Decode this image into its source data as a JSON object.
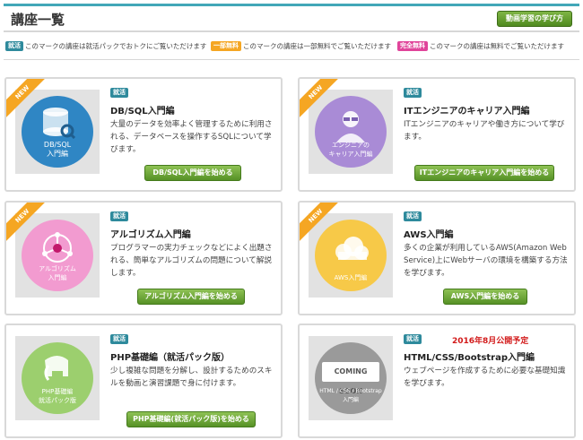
{
  "header": {
    "title": "講座一覧",
    "how_to_button": "動画学習の学び方"
  },
  "legend": [
    {
      "chip": "就活",
      "chip_color": "#2e8a9c",
      "text": "このマークの講座は就活パックでおトクにご覧いただけます"
    },
    {
      "chip": "一部無料",
      "chip_color": "#f5a623",
      "text": "このマークの講座は一部無料でご覧いただけます"
    },
    {
      "chip": "完全無料",
      "chip_color": "#e0449a",
      "text": "このマークの講座は無料でご覧いただけます"
    }
  ],
  "courses": [
    {
      "ribbon": "NEW",
      "tag": "就活",
      "title": "DB/SQL入門編",
      "desc": "大量のデータを効率よく管理するために利用される、データベースを操作するSQLについて学びます。",
      "thumb_label": "DB/SQL\n入門編",
      "thumb_color": "#2f86c4",
      "icon": "database-icon",
      "button": "DB/SQL入門編を始める"
    },
    {
      "ribbon": "NEW",
      "tag": "就活",
      "title": "ITエンジニアのキャリア入門編",
      "desc": "ITエンジニアのキャリアや働き方について学びます。",
      "thumb_label": "エンジニアの\nキャリア入門編",
      "thumb_color": "#a98bd6",
      "icon": "engineer-icon",
      "button": "ITエンジニアのキャリア入門編を始める"
    },
    {
      "ribbon": "NEW",
      "tag": "就活",
      "title": "アルゴリズム入門編",
      "desc": "プログラマーの実力チェックなどによく出題される、簡単なアルゴリズムの問題について解説します。",
      "thumb_label": "アルゴリズム\n入門編",
      "thumb_color": "#f29bd0",
      "icon": "network-icon",
      "button": "アルゴリズム入門編を始める"
    },
    {
      "ribbon": "NEW",
      "tag": "就活",
      "title": "AWS入門編",
      "desc": "多くの企業が利用しているAWS(Amazon Web Service)上にWebサーバの環境を構築する方法を学びます。",
      "thumb_label": "AWS入門編",
      "thumb_color": "#f7c948",
      "icon": "cloud-icon",
      "button": "AWS入門編を始める"
    },
    {
      "ribbon": "",
      "tag": "就活",
      "title": "PHP基礎編（就活パック版）",
      "desc": "少し複雑な問題を分解し、設計するためのスキルを動画と演習課題で身に付けます。",
      "thumb_label": "PHP基礎編\n就活パック版",
      "thumb_color": "#9ccf6e",
      "icon": "php-elephant-icon",
      "button": "PHP基礎編(就活パック版)を始める"
    },
    {
      "ribbon": "",
      "tag": "就活",
      "announce": "2016年8月公開予定",
      "title": "HTML/CSS/Bootstrap入門編",
      "desc": "ウェブページを作成するために必要な基礎知識を学びます。",
      "thumb_label": "HTML / CSS / Bootstrap\n入門編",
      "thumb_color": "#9a9a9a",
      "icon": "coming-soon-icon",
      "coming_soon": "COMING SOON",
      "button": ""
    }
  ]
}
